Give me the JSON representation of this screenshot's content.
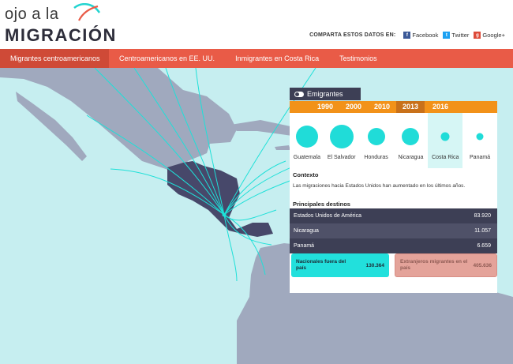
{
  "header": {
    "logo_line1": "ojo a la",
    "logo_line2": "MIGRACIÓN",
    "share_label": "COMPARTA ESTOS DATOS EN:",
    "share": [
      {
        "label": "Facebook",
        "icon": "facebook-icon",
        "color": "#3b5998",
        "glyph": "f"
      },
      {
        "label": "Twitter",
        "icon": "twitter-icon",
        "color": "#1da1f2",
        "glyph": "t"
      },
      {
        "label": "Google+",
        "icon": "googleplus-icon",
        "color": "#dd4b39",
        "glyph": "g"
      }
    ]
  },
  "nav": [
    {
      "label": "Migrantes centroamericanos",
      "active": true
    },
    {
      "label": "Centroamericanos en EE. UU.",
      "active": false
    },
    {
      "label": "Inmigrantes en Costa Rica",
      "active": false
    },
    {
      "label": "Testimonios",
      "active": false
    }
  ],
  "panel": {
    "toggle_label": "Emigrantes",
    "years": [
      "1990",
      "2000",
      "2010",
      "2013",
      "2016"
    ],
    "active_year": "2013",
    "countries": [
      "Guatemala",
      "El Salvador",
      "Honduras",
      "Nicaragua",
      "Costa Rica",
      "Panamá"
    ],
    "active_country": "Costa Rica",
    "context_title": "Contexto",
    "context_text": "Las migraciones hacia Estados Unidos han aumentado en los últimos años.",
    "destinations_title": "Principales destinos",
    "destinations": [
      {
        "name": "Estados Unidos de América",
        "value": "83.920"
      },
      {
        "name": "Nicaragua",
        "value": "11.057"
      },
      {
        "name": "Panamá",
        "value": "6.659"
      }
    ]
  },
  "summary": {
    "nationals_label": "Nacionales fuera del país",
    "nationals_value": "130.364",
    "foreign_label": "Extranjeros migrantes en el país",
    "foreign_value": "405.636"
  },
  "colors": {
    "accent": "#e95b47",
    "teal": "#20dcd8",
    "dark": "#3d3f55",
    "orange": "#f29219",
    "sea": "#c6eef0",
    "land": "#a0a9be",
    "highlight": "#47486a"
  }
}
